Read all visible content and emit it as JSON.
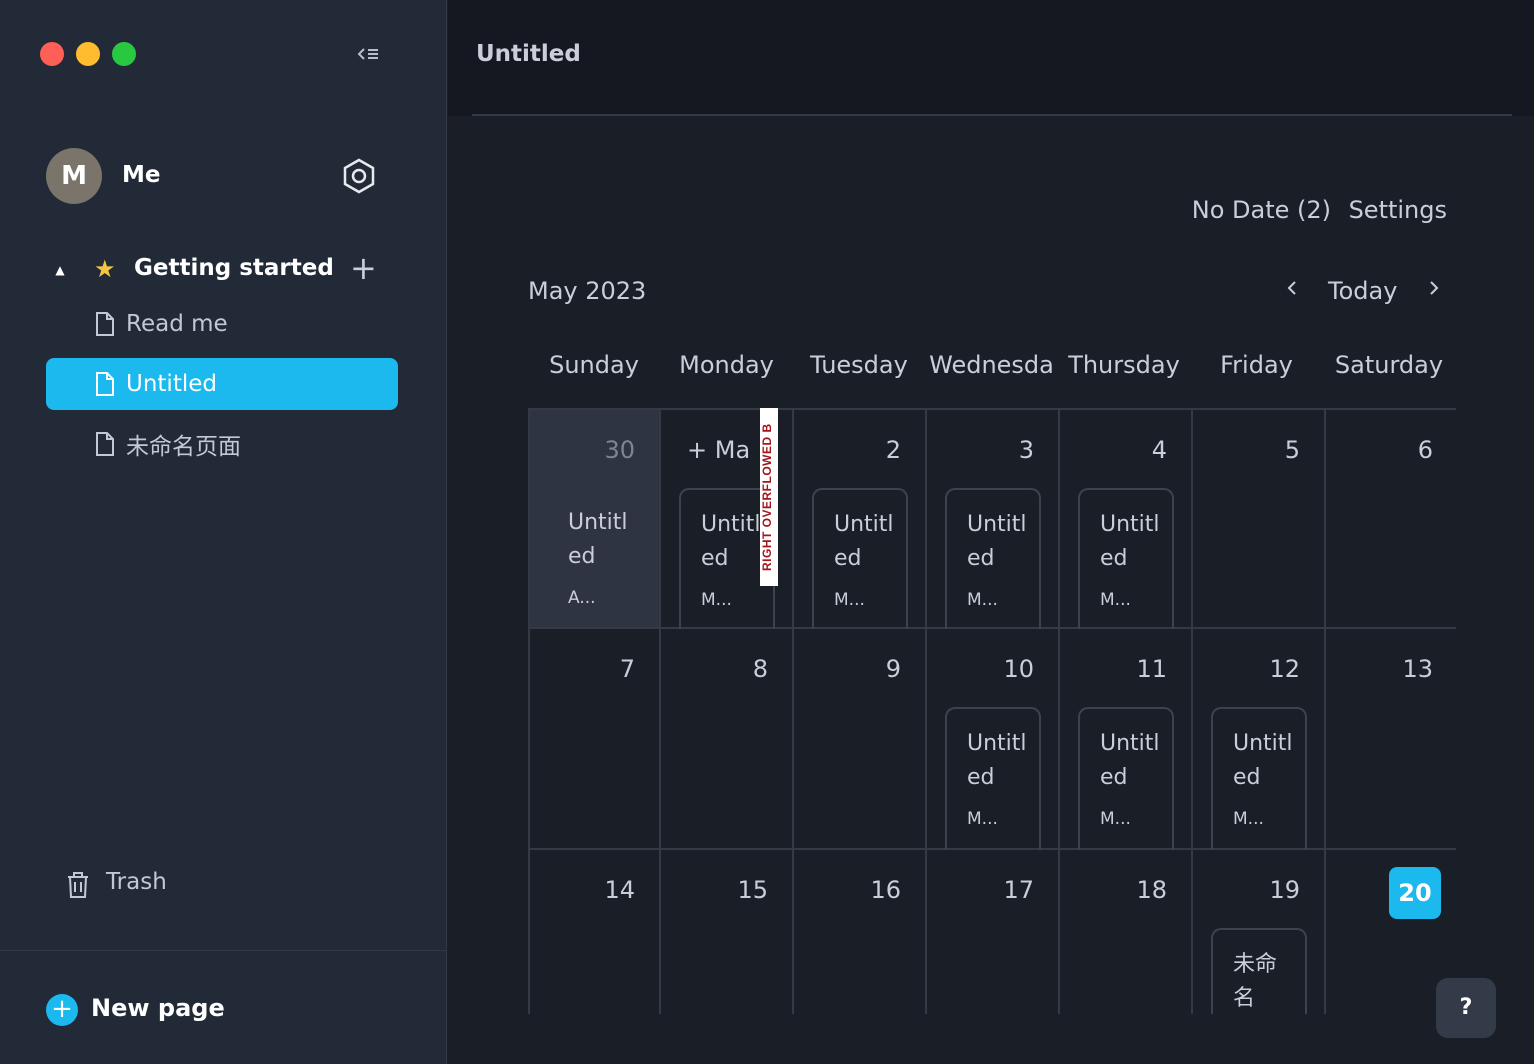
{
  "sidebar": {
    "user": {
      "avatar_letter": "M",
      "name": "Me"
    },
    "section": {
      "title": "Getting started"
    },
    "pages": [
      {
        "label": "Read me",
        "active": false
      },
      {
        "label": "Untitled",
        "active": true
      },
      {
        "label": "未命名页面",
        "active": false
      }
    ],
    "trash_label": "Trash",
    "new_page_label": "New page",
    "accent_color": "#1bb9ee"
  },
  "header": {
    "title": "Untitled"
  },
  "calendar": {
    "no_date_label": "No Date (2)",
    "settings_label": "Settings",
    "month_label": "May 2023",
    "today_label": "Today",
    "prev_icon": "‹",
    "next_icon": "›",
    "weekdays": [
      "Sunday",
      "Monday",
      "Tuesday",
      "Wednesda",
      "Thursday",
      "Friday",
      "Saturday"
    ],
    "add_inline_label": "+ Ma",
    "overflow_tag": "RIGHT OVERFLOWED B",
    "help_label": "?",
    "weeks": [
      [
        {
          "day": "30",
          "outside": true,
          "card": {
            "title": "Untitled",
            "meta": "A..."
          }
        },
        {
          "day": "",
          "add": true,
          "card": {
            "title": "Untitled",
            "meta": "M..."
          }
        },
        {
          "day": "2",
          "card": {
            "title": "Untitled",
            "meta": "M..."
          }
        },
        {
          "day": "3",
          "card": {
            "title": "Untitled",
            "meta": "M..."
          }
        },
        {
          "day": "4",
          "card": {
            "title": "Untitled",
            "meta": "M..."
          }
        },
        {
          "day": "5"
        },
        {
          "day": "6"
        }
      ],
      [
        {
          "day": "7"
        },
        {
          "day": "8"
        },
        {
          "day": "9"
        },
        {
          "day": "10",
          "card": {
            "title": "Untitled",
            "meta": "M..."
          }
        },
        {
          "day": "11",
          "card": {
            "title": "Untitled",
            "meta": "M..."
          }
        },
        {
          "day": "12",
          "card": {
            "title": "Untitled",
            "meta": "M..."
          }
        },
        {
          "day": "13"
        }
      ],
      [
        {
          "day": "14"
        },
        {
          "day": "15"
        },
        {
          "day": "16"
        },
        {
          "day": "17"
        },
        {
          "day": "18"
        },
        {
          "day": "19",
          "card": {
            "title": "未命名",
            "meta": ""
          }
        },
        {
          "day": "20",
          "today": true
        }
      ]
    ]
  }
}
